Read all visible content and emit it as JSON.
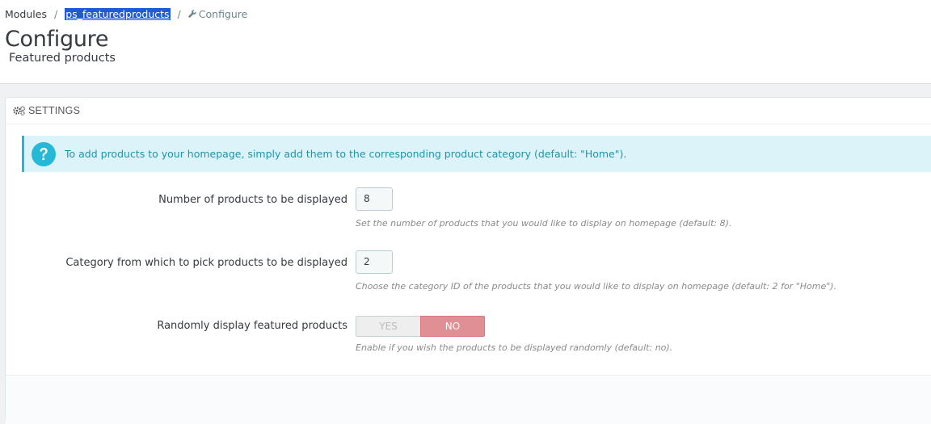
{
  "breadcrumb": {
    "items": [
      "Modules",
      "ps_featuredproducts",
      "Configure"
    ],
    "separator": "/"
  },
  "header": {
    "title": "Configure",
    "subtitle": "Featured products"
  },
  "panel": {
    "heading": "SETTINGS",
    "heading_icon": "cogs-icon",
    "alert": {
      "icon": "question-circle-icon",
      "text": "To add products to your homepage, simply add them to the corresponding product category (default: \"Home\")."
    },
    "fields": [
      {
        "label": "Number of products to be displayed",
        "value": "8",
        "help": "Set the number of products that you would like to display on homepage (default: 8)."
      },
      {
        "label": "Category from which to pick products to be displayed",
        "value": "2",
        "help": "Choose the category ID of the products that you would like to display on homepage (default: 2 for \"Home\")."
      },
      {
        "label": "Randomly display featured products",
        "yes_label": "YES",
        "no_label": "NO",
        "selected": "NO",
        "help": "Enable if you wish the products to be displayed randomly (default: no)."
      }
    ]
  },
  "colors": {
    "alert_bg": "#dcf4f9",
    "alert_border": "#25b9d7",
    "alert_text": "#1e94ab",
    "switch_no_active": "#e08f95",
    "selection_highlight": "#1c5cd7"
  }
}
